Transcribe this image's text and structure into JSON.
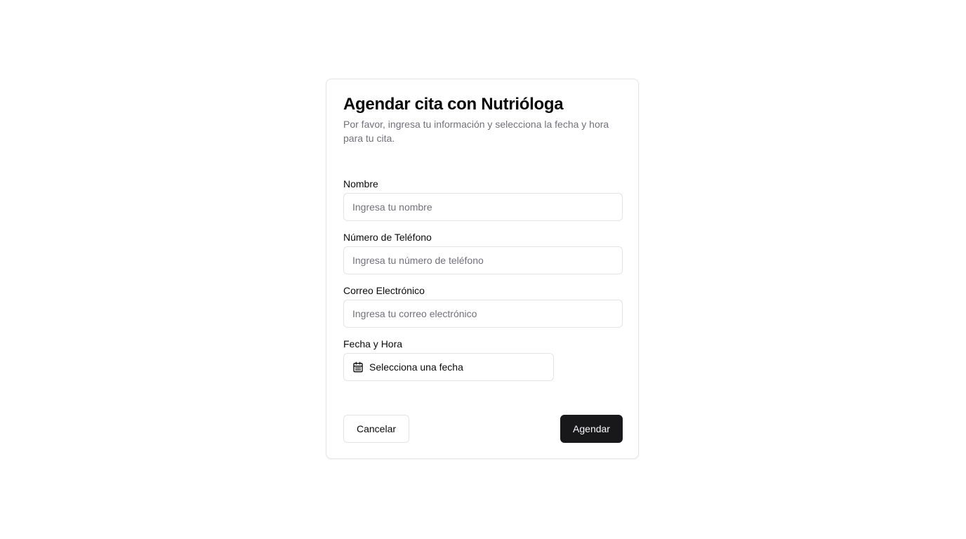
{
  "form": {
    "title": "Agendar cita con Nutrióloga",
    "description": "Por favor, ingresa tu información y selecciona la fecha y hora para tu cita.",
    "fields": {
      "name": {
        "label": "Nombre",
        "value": "",
        "placeholder": "Ingresa tu nombre"
      },
      "phone": {
        "label": "Número de Teléfono",
        "value": "",
        "placeholder": "Ingresa tu número de teléfono"
      },
      "email": {
        "label": "Correo Electrónico",
        "value": "",
        "placeholder": "Ingresa tu correo electrónico"
      },
      "datetime": {
        "label": "Fecha y Hora",
        "button_text": "Selecciona una fecha",
        "icon": "calendar-icon"
      }
    },
    "actions": {
      "cancel_label": "Cancelar",
      "submit_label": "Agendar"
    }
  },
  "colors": {
    "background": "#ffffff",
    "border": "#e4e4e7",
    "text": "#0a0a0a",
    "muted_text": "#71717a",
    "primary_button": "#18181b",
    "primary_button_text": "#fafafa"
  }
}
